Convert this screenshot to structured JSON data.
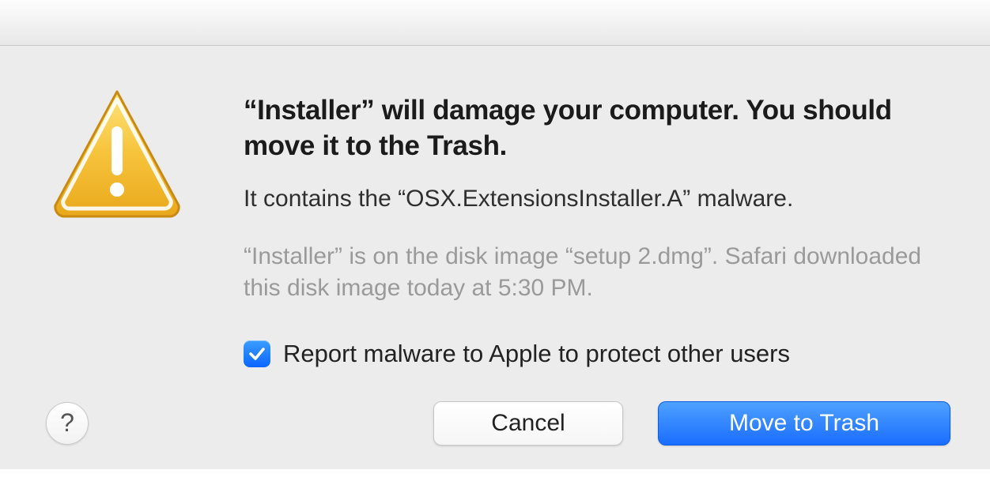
{
  "dialog": {
    "title": "“Installer” will damage your computer. You should move it to the Trash.",
    "subtitle": "It contains the “OSX.ExtensionsInstaller.A” malware.",
    "detail": "“Installer” is on the disk image “setup 2.dmg”. Safari downloaded this disk image today at 5:30 PM.",
    "checkbox_label": "Report malware to Apple to protect other users",
    "checkbox_checked": true,
    "help_label": "?",
    "cancel_label": "Cancel",
    "primary_label": "Move to Trash",
    "icon": "warning-triangle",
    "colors": {
      "accent": "#1a6dff",
      "warning": "#f6c33b"
    }
  }
}
